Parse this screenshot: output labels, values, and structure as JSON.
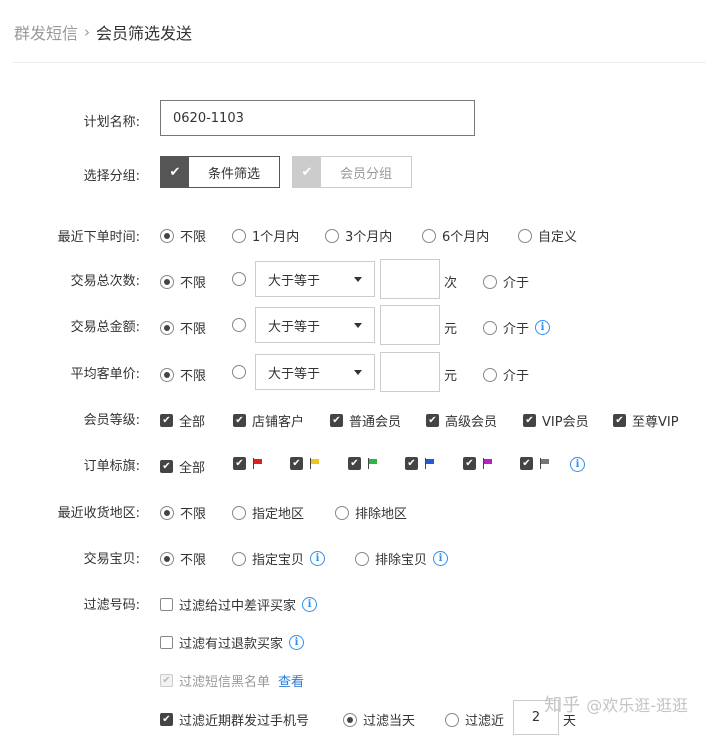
{
  "breadcrumb": {
    "parent": "群发短信",
    "current": "会员筛选发送"
  },
  "form": {
    "plan_name": {
      "label": "计划名称:",
      "value": "0620-1103"
    },
    "group": {
      "label": "选择分组:",
      "option_filter": "条件筛选",
      "option_member": "会员分组",
      "selected": "条件筛选"
    },
    "recent_order": {
      "label": "最近下单时间:",
      "options": [
        "不限",
        "1个月内",
        "3个月内",
        "6个月内",
        "自定义"
      ],
      "selected": "不限"
    },
    "trade_count": {
      "label": "交易总次数:",
      "unlimited": "不限",
      "operator": "大于等于",
      "unit": "次",
      "between": "介于"
    },
    "trade_amount": {
      "label": "交易总金额:",
      "unlimited": "不限",
      "operator": "大于等于",
      "unit": "元",
      "between": "介于"
    },
    "avg_price": {
      "label": "平均客单价:",
      "unlimited": "不限",
      "operator": "大于等于",
      "unit": "元",
      "between": "介于"
    },
    "member_level": {
      "label": "会员等级:",
      "options": [
        "全部",
        "店铺客户",
        "普通会员",
        "高级会员",
        "VIP会员",
        "至尊VIP"
      ]
    },
    "order_flag": {
      "label": "订单标旗:",
      "all": "全部",
      "flags": [
        "#e02020",
        "#f0c419",
        "#2fb344",
        "#2458d6",
        "#b620c9",
        "#777777"
      ]
    },
    "recent_region": {
      "label": "最近收货地区:",
      "options": [
        "不限",
        "指定地区",
        "排除地区"
      ],
      "selected": "不限"
    },
    "trade_item": {
      "label": "交易宝贝:",
      "options": [
        "不限",
        "指定宝贝",
        "排除宝贝"
      ],
      "selected": "不限"
    },
    "filter_numbers": {
      "label": "过滤号码:",
      "bad_review": "过滤给过中差评买家",
      "refund": "过滤有过退款买家",
      "blacklist": "过滤短信黑名单",
      "blacklist_link": "查看",
      "recent_sent": "过滤近期群发过手机号",
      "today": "过滤当天",
      "recent_prefix": "过滤近",
      "recent_days": "2",
      "recent_unit": "天"
    }
  },
  "watermark": {
    "logo": "知乎",
    "text": "@欢乐逛-逛逛"
  }
}
